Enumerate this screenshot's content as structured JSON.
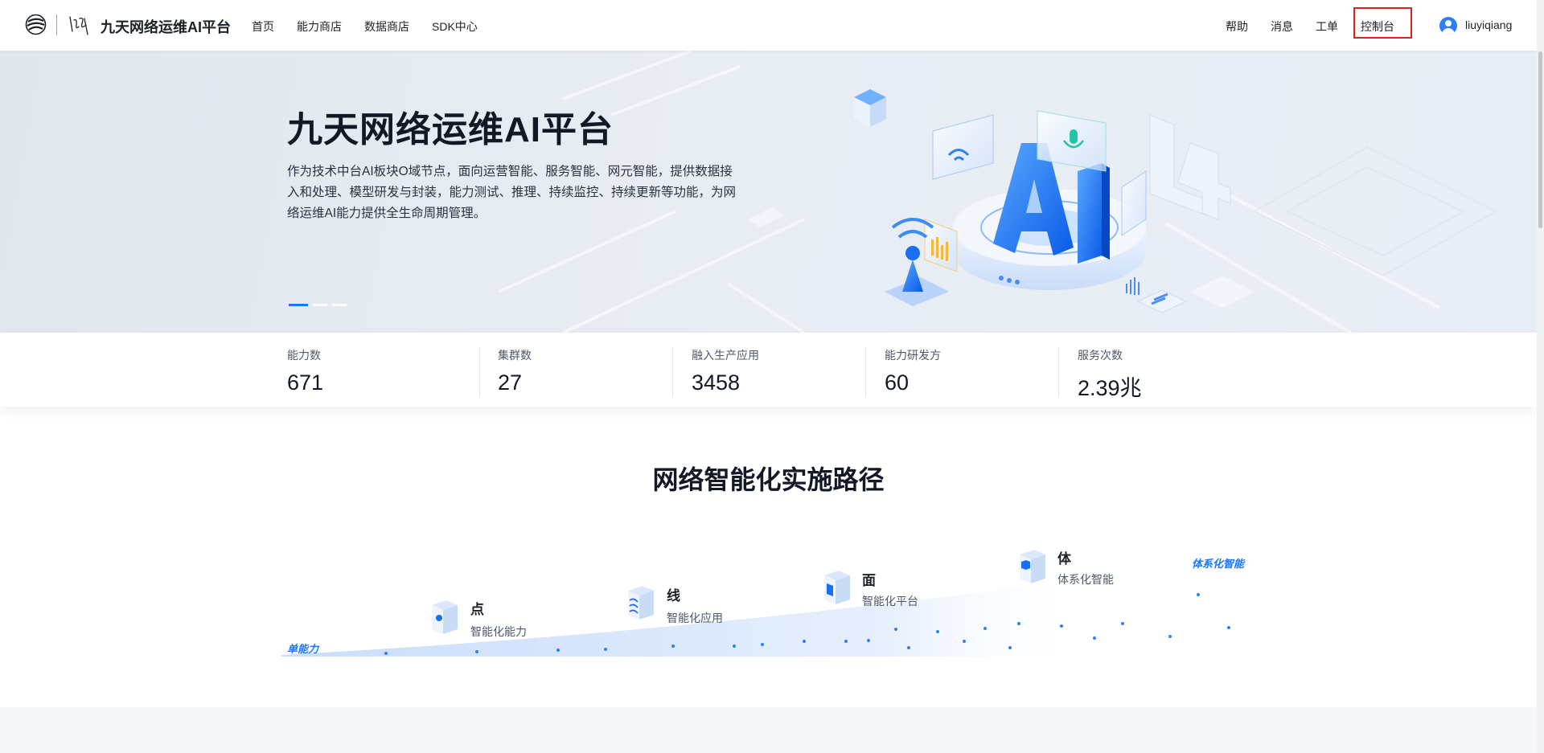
{
  "header": {
    "brand": "九天网络运维AI平台",
    "nav": [
      "首页",
      "能力商店",
      "数据商店",
      "SDK中心"
    ],
    "right_nav": [
      "帮助",
      "消息",
      "工单",
      "控制台"
    ],
    "username": "liuyiqiang",
    "highlight_color": "#e0201e"
  },
  "hero": {
    "title": "九天网络运维AI平台",
    "description": "作为技术中台AI板块O域节点，面向运营智能、服务智能、网元智能，提供数据接入和处理、模型研发与封装，能力测试、推理、持续监控、持续更新等功能，为网络运维AI能力提供全生命周期管理。",
    "art_text": {
      "ai": "AI",
      "level": "L4"
    },
    "carousel": {
      "count": 3,
      "active_index": 0
    }
  },
  "stats": [
    {
      "label": "能力数",
      "value": "671"
    },
    {
      "label": "集群数",
      "value": "27"
    },
    {
      "label": "融入生产应用",
      "value": "3458"
    },
    {
      "label": "能力研发方",
      "value": "60"
    },
    {
      "label": "服务次数",
      "value": "2.39兆"
    }
  ],
  "path": {
    "title": "网络智能化实施路径",
    "start_label": "单能力",
    "end_label": "体系化智能",
    "stages": [
      {
        "name": "点",
        "desc": "智能化能力"
      },
      {
        "name": "线",
        "desc": "智能化应用"
      },
      {
        "name": "面",
        "desc": "智能化平台"
      },
      {
        "name": "体",
        "desc": "体系化智能"
      }
    ]
  },
  "colors": {
    "accent": "#1677ff",
    "title": "#121826",
    "text": "#4e5969"
  }
}
